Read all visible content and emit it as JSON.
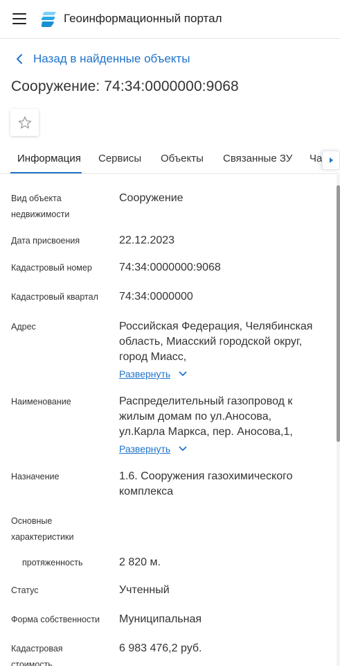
{
  "header": {
    "title": "Геоинформационный портал",
    "menu_icon": "hamburger-menu-icon",
    "logo_icon": "portal-logo-icon"
  },
  "back_link": {
    "label": "Назад в найденные объекты"
  },
  "page": {
    "title": "Сооружение: 74:34:0000000:9068"
  },
  "favorite": {
    "icon": "star-icon"
  },
  "tabs": [
    {
      "label": "Информация",
      "active": true
    },
    {
      "label": "Сервисы"
    },
    {
      "label": "Объекты"
    },
    {
      "label": "Связанные ЗУ"
    },
    {
      "label": "Ча"
    }
  ],
  "info": {
    "object_type": {
      "label": "Вид объекта недвижимости",
      "value": "Сооружение"
    },
    "assign_date": {
      "label": "Дата присвоения",
      "value": "22.12.2023"
    },
    "cadastral_number": {
      "label": "Кадастровый номер",
      "value": "74:34:0000000:9068"
    },
    "cadastral_block": {
      "label": "Кадастровый квартал",
      "value": "74:34:0000000"
    },
    "address": {
      "label": "Адрес",
      "value": "Российская Федерация, Челябинская область, Миасский городской округ, город Миасс,",
      "expand": "Развернуть"
    },
    "name": {
      "label": "Наименование",
      "value": "Распределительный газопровод к жилым домам по ул.Аносова, ул.Карла Маркса, пер. Аносова,1,",
      "expand": "Развернуть"
    },
    "purpose": {
      "label": "Назначение",
      "value": "1.6. Сооружения газохимического комплекса"
    },
    "main_characteristics": {
      "label": "Основные характеристики"
    },
    "length": {
      "label": "протяженность",
      "value": "2 820 м."
    },
    "status": {
      "label": "Статус",
      "value": "Учтенный"
    },
    "ownership": {
      "label": "Форма собственности",
      "value": "Муниципальная"
    },
    "cadastral_value": {
      "label": "Кадастровая стоимость",
      "value": "6 983 476,2 руб."
    }
  },
  "colors": {
    "accent": "#1f73c9",
    "logo_light": "#7fd0f7",
    "logo_dark": "#2ba8e8"
  }
}
